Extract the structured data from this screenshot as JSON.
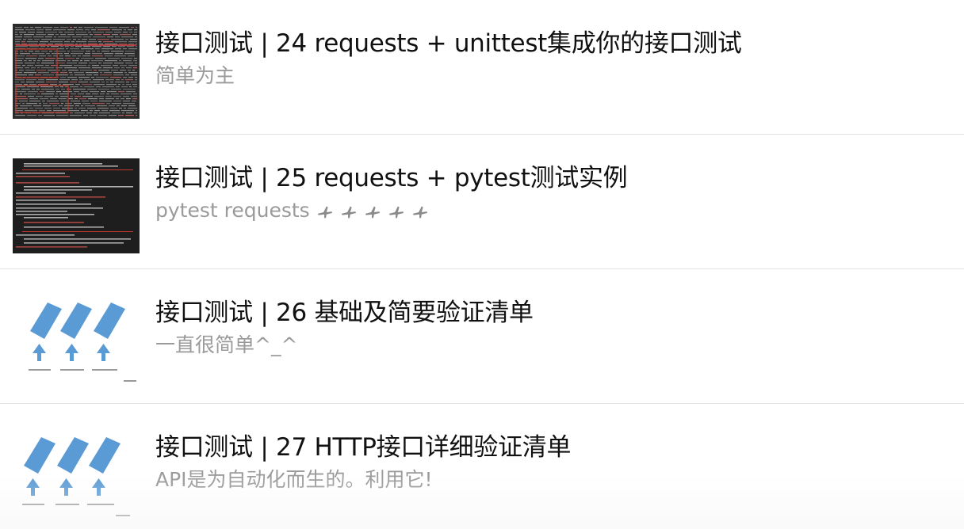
{
  "articles": [
    {
      "title": "接口测试 | 24 requests + unittest集成你的接口测试",
      "subtitle": "简单为主",
      "thumbnail": "terminal-screenshot-red-highlight-icon"
    },
    {
      "title": "接口测试 | 25 requests + pytest测试实例",
      "subtitle": "pytest requests",
      "subtitle_icons": [
        "airplane-icon",
        "airplane-icon",
        "airplane-icon",
        "airplane-icon",
        "airplane-icon"
      ],
      "thumbnail": "terminal-screenshot-dark-icon"
    },
    {
      "title": "接口测试 | 26 基础及简要验证清单",
      "subtitle": "一直很简单^_^",
      "thumbnail": "blue-diamond-diagram-icon"
    },
    {
      "title": "接口测试 | 27 HTTP接口详细验证清单",
      "subtitle": "API是为自动化而生的。利用它!",
      "thumbnail": "blue-diamond-diagram-icon"
    }
  ],
  "colors": {
    "title": "#111111",
    "subtitle": "#9a9a9a",
    "divider": "#e3e3e3",
    "diagram_blue": "#5b9bd5"
  }
}
